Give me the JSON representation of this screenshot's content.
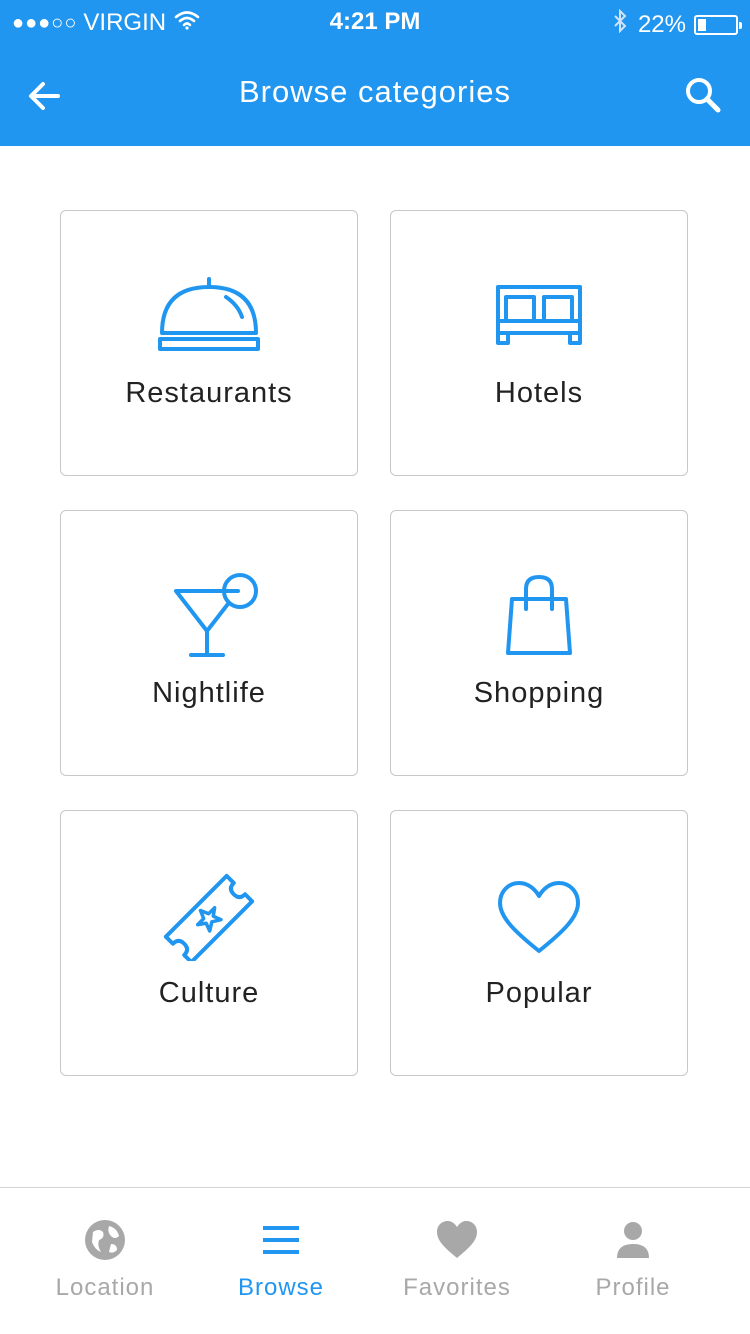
{
  "status_bar": {
    "signal_dots": "●●●○○",
    "carrier": "VIRGIN",
    "time": "4:21 PM",
    "battery_percent": "22%",
    "battery_level": 0.22
  },
  "header": {
    "title": "Browse categories",
    "background_color": "#2196F0"
  },
  "categories": [
    {
      "label": "Restaurants",
      "icon": "cloche-icon"
    },
    {
      "label": "Hotels",
      "icon": "bed-icon"
    },
    {
      "label": "Nightlife",
      "icon": "cocktail-icon"
    },
    {
      "label": "Shopping",
      "icon": "shopping-bag-icon"
    },
    {
      "label": "Culture",
      "icon": "ticket-icon"
    },
    {
      "label": "Popular",
      "icon": "heart-outline-icon"
    }
  ],
  "tabbar": {
    "active": "Browse",
    "active_color": "#2196F0",
    "inactive_color": "#A8A8A8",
    "items": [
      {
        "label": "Location",
        "icon": "globe-icon"
      },
      {
        "label": "Browse",
        "icon": "menu-icon"
      },
      {
        "label": "Favorites",
        "icon": "heart-icon"
      },
      {
        "label": "Profile",
        "icon": "user-icon"
      }
    ]
  }
}
